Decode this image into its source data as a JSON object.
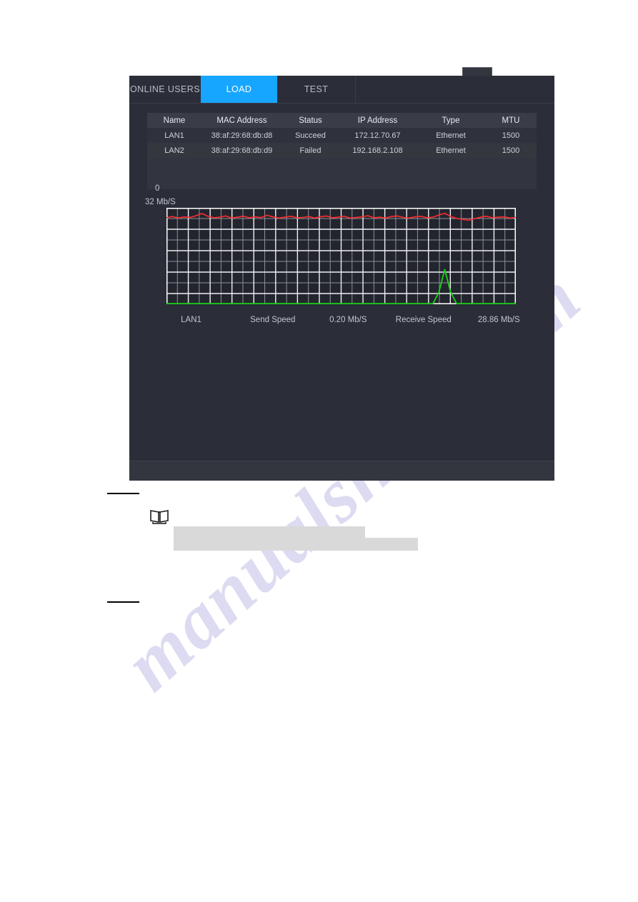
{
  "panel": {
    "tabs": [
      {
        "id": "online-users",
        "label": "ONLINE USERS",
        "active": false
      },
      {
        "id": "load",
        "label": "LOAD",
        "active": true
      },
      {
        "id": "test",
        "label": "TEST",
        "active": false
      }
    ],
    "accent_color": "#17a6ff",
    "background_color": "#2b2d38"
  },
  "table": {
    "columns": [
      "Name",
      "MAC Address",
      "Status",
      "IP Address",
      "Type",
      "MTU"
    ],
    "rows": [
      {
        "name": "LAN1",
        "mac": "38:af:29:68:db:d8",
        "status": "Succeed",
        "ip": "172.12.70.67",
        "type": "Ethernet",
        "mtu": "1500"
      },
      {
        "name": "LAN2",
        "mac": "38:af:29:68:db:d9",
        "status": "Failed",
        "ip": "192.168.2.108",
        "type": "Ethernet",
        "mtu": "1500"
      }
    ]
  },
  "legend": {
    "interface": "LAN1",
    "send_label": "Send Speed",
    "send_value": "0.20 Mb/S",
    "receive_label": "Receive Speed",
    "receive_value": "28.86 Mb/S",
    "send_color": "#17d417",
    "receive_color": "#ff2d2d"
  },
  "chart_data": {
    "type": "line",
    "title": "",
    "xlabel": "",
    "ylabel": "Mb/S",
    "ylim": [
      0,
      32
    ],
    "y_tick_labels": [
      "32 Mb/S",
      "0"
    ],
    "grid": true,
    "grid_major_cols": 16,
    "grid_major_rows": 5,
    "grid_minor_rows": 9,
    "legend_position": "bottom",
    "series": [
      {
        "name": "Receive Speed",
        "color": "#ff2d2d",
        "current_value": 28.86,
        "unit": "Mb/S",
        "values": [
          28.7,
          29.1,
          28.6,
          29.0,
          28.8,
          29.4,
          30.1,
          29.2,
          28.7,
          28.9,
          29.3,
          28.6,
          28.9,
          29.2,
          28.7,
          29.0,
          28.8,
          29.5,
          29.0,
          28.6,
          28.9,
          29.2,
          28.7,
          28.8,
          29.1,
          28.6,
          29.0,
          29.3,
          28.7,
          28.9,
          29.2,
          28.6,
          28.8,
          29.0,
          29.4,
          28.7,
          28.9,
          28.6,
          29.1,
          29.3,
          28.8,
          28.6,
          29.0,
          29.2,
          28.7,
          28.9,
          29.6,
          30.2,
          29.1,
          28.5,
          28.2,
          27.9,
          28.4,
          28.9,
          29.2,
          28.7,
          28.9,
          29.0,
          28.6,
          28.8
        ]
      },
      {
        "name": "Send Speed",
        "color": "#17d417",
        "current_value": 0.2,
        "unit": "Mb/S",
        "spike_index": 47,
        "spike_value": 11.5,
        "values": [
          0.2,
          0.2,
          0.2,
          0.2,
          0.2,
          0.2,
          0.2,
          0.2,
          0.2,
          0.2,
          0.2,
          0.2,
          0.2,
          0.2,
          0.2,
          0.2,
          0.2,
          0.2,
          0.2,
          0.2,
          0.2,
          0.2,
          0.2,
          0.2,
          0.2,
          0.2,
          0.2,
          0.2,
          0.2,
          0.2,
          0.2,
          0.2,
          0.2,
          0.2,
          0.2,
          0.2,
          0.2,
          0.2,
          0.2,
          0.2,
          0.2,
          0.2,
          0.2,
          0.2,
          0.2,
          0.2,
          4.0,
          11.5,
          4.0,
          0.2,
          0.2,
          0.2,
          0.2,
          0.2,
          0.2,
          0.2,
          0.2,
          0.2,
          0.2,
          0.2
        ]
      }
    ]
  },
  "note": {
    "icon": "book-icon",
    "redacted_line_1": "",
    "redacted_line_2": ""
  },
  "watermark": {
    "text": "manualshive.com"
  }
}
